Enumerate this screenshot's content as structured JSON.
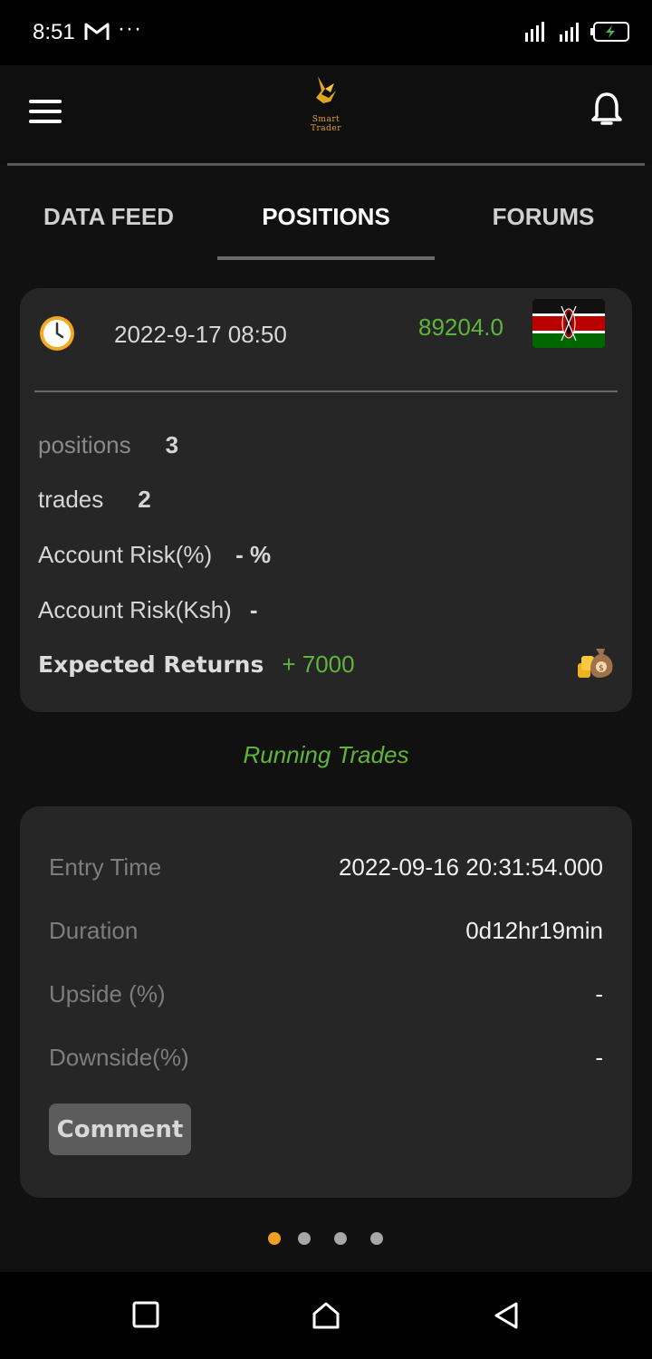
{
  "status_bar": {
    "time": "8:51",
    "dots": "···"
  },
  "app": {
    "logo_text": "Smart Trader",
    "accent_color": "#5fb53a",
    "logo_color": "#e0a520"
  },
  "tabs": [
    {
      "label": "DATA FEED",
      "active": false
    },
    {
      "label": "POSITIONS",
      "active": true
    },
    {
      "label": "FORUMS",
      "active": false
    }
  ],
  "summary": {
    "date": "2022-9-17 08:50",
    "balance": "89204.0",
    "flag": "kenya-flag",
    "positions_label": "positions",
    "positions_value": "3",
    "trades_label": "trades",
    "trades_value": "2",
    "risk_pct_label": "Account Risk(%)",
    "risk_pct_value": "- %",
    "risk_ksh_label": "Account Risk(Ksh)",
    "risk_ksh_value": "-",
    "returns_label": "Expected Returns",
    "returns_value": "+ 7000"
  },
  "running_trades_label": "Running Trades",
  "trade": {
    "entry_time_label": "Entry Time",
    "entry_time_value": "2022-09-16 20:31:54.000",
    "duration_label": "Duration",
    "duration_value": "0d12hr19min",
    "upside_label": "Upside (%)",
    "upside_value": "-",
    "downside_label": "Downside(%)",
    "downside_value": "-",
    "comment_label": "Comment"
  },
  "pager": {
    "count": 4,
    "active_index": 0
  }
}
